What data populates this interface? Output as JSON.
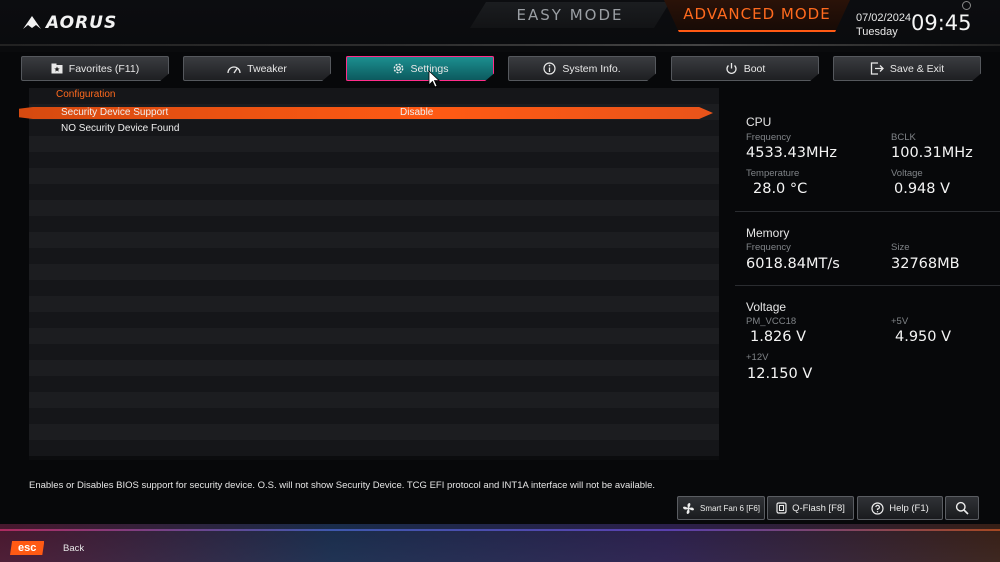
{
  "header": {
    "brand": "AORUS",
    "easy_mode": "EASY MODE",
    "advanced_mode": "ADVANCED MODE",
    "date": "07/02/2024",
    "day": "Tuesday",
    "time": "09:45"
  },
  "tabs": [
    {
      "label": "Favorites (F11)",
      "icon": "star-folder-icon"
    },
    {
      "label": "Tweaker",
      "icon": "gauge-icon"
    },
    {
      "label": "Settings",
      "icon": "gear-icon",
      "active": true
    },
    {
      "label": "System Info.",
      "icon": "info-icon"
    },
    {
      "label": "Boot",
      "icon": "power-icon"
    },
    {
      "label": "Save & Exit",
      "icon": "exit-icon"
    }
  ],
  "main": {
    "section": "Configuration",
    "items": [
      {
        "label": "Security Device Support",
        "value": "Disable",
        "selected": true
      },
      {
        "label": "NO Security Device Found",
        "value": ""
      }
    ]
  },
  "info": {
    "cpu": {
      "title": "CPU",
      "frequency_label": "Frequency",
      "frequency": "4533.43MHz",
      "bclk_label": "BCLK",
      "bclk": "100.31MHz",
      "temperature_label": "Temperature",
      "temperature": "28.0 °C",
      "voltage_label": "Voltage",
      "voltage": "0.948 V"
    },
    "memory": {
      "title": "Memory",
      "frequency_label": "Frequency",
      "frequency": "6018.84MT/s",
      "size_label": "Size",
      "size": "32768MB"
    },
    "voltage": {
      "title": "Voltage",
      "pmvcc18_label": "PM_VCC18",
      "pmvcc18": "1.826 V",
      "p5v_label": "+5V",
      "p5v": "4.950 V",
      "p12v_label": "+12V",
      "p12v": "12.150 V"
    }
  },
  "help_text": "Enables or Disables BIOS support for security device. O.S. will not show Security Device. TCG EFI protocol and INT1A interface will not be available.",
  "bottom_buttons": {
    "smart_fan": "Smart Fan 6 [F6]",
    "qflash": "Q-Flash [F8]",
    "help": "Help (F1)"
  },
  "footer": {
    "esc_key": "esc",
    "esc_label": "Back"
  },
  "colors": {
    "accent": "#ff5a14",
    "active_tab": "#1c8f90",
    "active_tab_border": "#ff2d8a"
  }
}
